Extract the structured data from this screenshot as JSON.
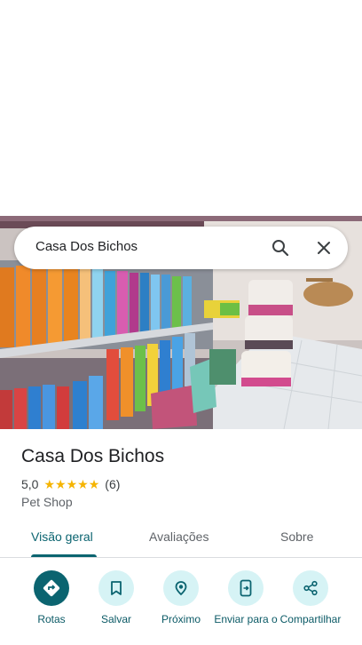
{
  "search": {
    "query": "Casa Dos Bichos"
  },
  "place": {
    "name": "Casa Dos Bichos",
    "rating": "5,0",
    "stars": 5,
    "review_count": "(6)",
    "category": "Pet Shop"
  },
  "tabs": [
    {
      "label": "Visão geral",
      "active": true
    },
    {
      "label": "Avaliações",
      "active": false
    },
    {
      "label": "Sobre",
      "active": false
    }
  ],
  "actions": [
    {
      "label": "Rotas",
      "icon": "directions-icon"
    },
    {
      "label": "Salvar",
      "icon": "bookmark-icon"
    },
    {
      "label": "Próximo",
      "icon": "nearby-icon"
    },
    {
      "label": "Enviar para o",
      "icon": "send-to-phone-icon"
    },
    {
      "label": "Compartilhar",
      "icon": "share-icon"
    }
  ],
  "colors": {
    "accent": "#0b6470",
    "action_bg": "#d6f3f5",
    "star": "#f5b400"
  }
}
